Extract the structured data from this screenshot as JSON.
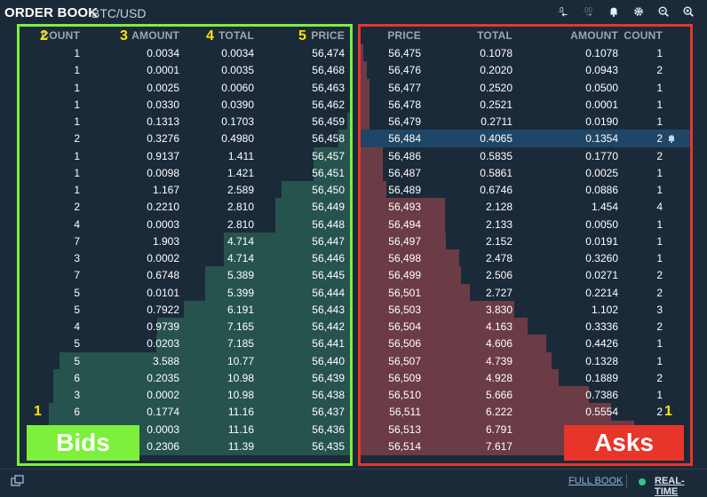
{
  "header": {
    "title": "ORDER BOOK",
    "pair": "BTC/USD",
    "decimals_less": ".0",
    "decimals_more": ".00"
  },
  "icons": [
    "decrease-decimals-icon",
    "increase-decimals-icon",
    "bell-icon",
    "gear-icon",
    "zoom-out-icon",
    "zoom-in-icon"
  ],
  "bids_headers": {
    "count": "COUNT",
    "amount": "AMOUNT",
    "total": "TOTAL",
    "price": "PRICE"
  },
  "asks_headers": {
    "price": "PRICE",
    "total": "TOTAL",
    "amount": "AMOUNT",
    "count": "COUNT"
  },
  "annotations": {
    "n1": "1",
    "n2": "2",
    "n3": "3",
    "n4": "4",
    "n5": "5",
    "bids_label": "Bids",
    "asks_label": "Asks",
    "asks_n1": "1"
  },
  "colors": {
    "bid_depth": "#27534f",
    "ask_depth": "#6b3c46",
    "bids_outline": "#7cf03c",
    "asks_outline": "#e8352a",
    "highlight": "#1f4667"
  },
  "bids": [
    {
      "count": "1",
      "amount": "0.0034",
      "total": "0.0034",
      "price": "56,474"
    },
    {
      "count": "1",
      "amount": "0.0001",
      "total": "0.0035",
      "price": "56,468"
    },
    {
      "count": "1",
      "amount": "0.0025",
      "total": "0.0060",
      "price": "56,463"
    },
    {
      "count": "1",
      "amount": "0.0330",
      "total": "0.0390",
      "price": "56,462"
    },
    {
      "count": "1",
      "amount": "0.1313",
      "total": "0.1703",
      "price": "56,459"
    },
    {
      "count": "2",
      "amount": "0.3276",
      "total": "0.4980",
      "price": "56,458"
    },
    {
      "count": "1",
      "amount": "0.9137",
      "total": "1.411",
      "price": "56,457"
    },
    {
      "count": "1",
      "amount": "0.0098",
      "total": "1.421",
      "price": "56,451"
    },
    {
      "count": "1",
      "amount": "1.167",
      "total": "2.589",
      "price": "56,450"
    },
    {
      "count": "2",
      "amount": "0.2210",
      "total": "2.810",
      "price": "56,449"
    },
    {
      "count": "4",
      "amount": "0.0003",
      "total": "2.810",
      "price": "56,448"
    },
    {
      "count": "7",
      "amount": "1.903",
      "total": "4.714",
      "price": "56,447"
    },
    {
      "count": "3",
      "amount": "0.0002",
      "total": "4.714",
      "price": "56,446"
    },
    {
      "count": "7",
      "amount": "0.6748",
      "total": "5.389",
      "price": "56,445"
    },
    {
      "count": "5",
      "amount": "0.0101",
      "total": "5.399",
      "price": "56,444"
    },
    {
      "count": "5",
      "amount": "0.7922",
      "total": "6.191",
      "price": "56,443"
    },
    {
      "count": "4",
      "amount": "0.9739",
      "total": "7.165",
      "price": "56,442"
    },
    {
      "count": "5",
      "amount": "0.0203",
      "total": "7.185",
      "price": "56,441"
    },
    {
      "count": "5",
      "amount": "3.588",
      "total": "10.77",
      "price": "56,440"
    },
    {
      "count": "6",
      "amount": "0.2035",
      "total": "10.98",
      "price": "56,439"
    },
    {
      "count": "3",
      "amount": "0.0002",
      "total": "10.98",
      "price": "56,438"
    },
    {
      "count": "6",
      "amount": "0.1774",
      "total": "11.16",
      "price": "56,437"
    },
    {
      "count": "",
      "amount": "0.0003",
      "total": "11.16",
      "price": "56,436"
    },
    {
      "count": "",
      "amount": "0.2306",
      "total": "11.39",
      "price": "56,435"
    }
  ],
  "asks": [
    {
      "price": "56,475",
      "total": "0.1078",
      "amount": "0.1078",
      "count": "1"
    },
    {
      "price": "56,476",
      "total": "0.2020",
      "amount": "0.0943",
      "count": "2"
    },
    {
      "price": "56,477",
      "total": "0.2520",
      "amount": "0.0500",
      "count": "1"
    },
    {
      "price": "56,478",
      "total": "0.2521",
      "amount": "0.0001",
      "count": "1"
    },
    {
      "price": "56,479",
      "total": "0.2711",
      "amount": "0.0190",
      "count": "1"
    },
    {
      "price": "56,484",
      "total": "0.4065",
      "amount": "0.1354",
      "count": "2"
    },
    {
      "price": "56,486",
      "total": "0.5835",
      "amount": "0.1770",
      "count": "2"
    },
    {
      "price": "56,487",
      "total": "0.5861",
      "amount": "0.0025",
      "count": "1"
    },
    {
      "price": "56,489",
      "total": "0.6746",
      "amount": "0.0886",
      "count": "1"
    },
    {
      "price": "56,493",
      "total": "2.128",
      "amount": "1.454",
      "count": "4"
    },
    {
      "price": "56,494",
      "total": "2.133",
      "amount": "0.0050",
      "count": "1"
    },
    {
      "price": "56,497",
      "total": "2.152",
      "amount": "0.0191",
      "count": "1"
    },
    {
      "price": "56,498",
      "total": "2.478",
      "amount": "0.3260",
      "count": "1"
    },
    {
      "price": "56,499",
      "total": "2.506",
      "amount": "0.0271",
      "count": "2"
    },
    {
      "price": "56,501",
      "total": "2.727",
      "amount": "0.2214",
      "count": "2"
    },
    {
      "price": "56,503",
      "total": "3.830",
      "amount": "1.102",
      "count": "3"
    },
    {
      "price": "56,504",
      "total": "4.163",
      "amount": "0.3336",
      "count": "2"
    },
    {
      "price": "56,506",
      "total": "4.606",
      "amount": "0.4426",
      "count": "1"
    },
    {
      "price": "56,507",
      "total": "4.739",
      "amount": "0.1328",
      "count": "1"
    },
    {
      "price": "56,509",
      "total": "4.928",
      "amount": "0.1889",
      "count": "2"
    },
    {
      "price": "56,510",
      "total": "5.666",
      "amount": "0.7386",
      "count": "1"
    },
    {
      "price": "56,511",
      "total": "6.222",
      "amount": "0.5554",
      "count": "2"
    },
    {
      "price": "56,513",
      "total": "6.791",
      "amount": "",
      "count": ""
    },
    {
      "price": "56,514",
      "total": "7.617",
      "amount": "",
      "count": ""
    }
  ],
  "highlighted_ask_index": 5,
  "footer": {
    "full_book": "FULL BOOK",
    "real_time": "REAL-TIME"
  }
}
